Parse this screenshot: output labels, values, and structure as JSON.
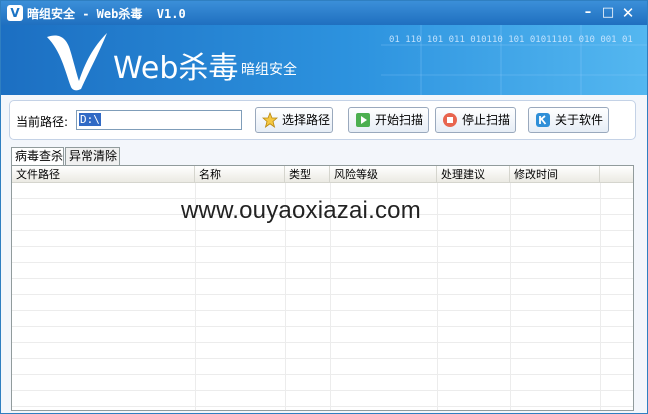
{
  "window": {
    "title": "暗组安全 - Web杀毒  V1.0",
    "controls": {
      "minimize": "–",
      "maximize": "□",
      "close": "✕"
    }
  },
  "banner": {
    "logo_letter": "V",
    "product": "Web杀毒",
    "company": "暗组安全",
    "binary_text": "01 110 101 011 010110 101 01011101 010 001 01"
  },
  "toolbar": {
    "path_label": "当前路径:",
    "path_value": "D:\\",
    "buttons": {
      "select_path": "选择路径",
      "start_scan": "开始扫描",
      "stop_scan": "停止扫描",
      "about": "关于软件"
    }
  },
  "tabs": [
    {
      "label": "病毒查杀",
      "active": true
    },
    {
      "label": "异常清除",
      "active": false
    }
  ],
  "table": {
    "columns": [
      "文件路径",
      "名称",
      "类型",
      "风险等级",
      "处理建议",
      "修改时间"
    ],
    "rows": []
  },
  "watermark": "www.ouyaoxiazai.com",
  "colors": {
    "title_bar": "#2a82d0",
    "banner": "#2d93df",
    "selection": "#316ac5"
  },
  "icons": {
    "app": "v-logo-icon",
    "select_path": "star-icon",
    "start_scan": "play-icon",
    "stop_scan": "stop-icon",
    "about": "info-k-icon"
  }
}
